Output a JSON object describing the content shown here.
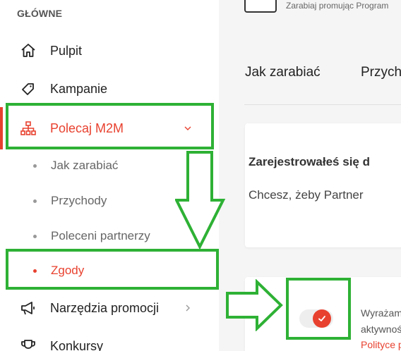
{
  "sidebar": {
    "section_title": "GŁÓWNE",
    "items": [
      {
        "label": "Pulpit",
        "icon": "home-icon"
      },
      {
        "label": "Kampanie",
        "icon": "tag-icon"
      },
      {
        "label": "Polecaj M2M",
        "icon": "sitemap-icon",
        "active": true,
        "expanded": true
      },
      {
        "label": "Narzędzia promocji",
        "icon": "megaphone-icon"
      },
      {
        "label": "Konkursy",
        "icon": "trophy-icon"
      }
    ],
    "subitems": [
      {
        "label": "Jak zarabiać"
      },
      {
        "label": "Przychody"
      },
      {
        "label": "Poleceni partnerzy"
      },
      {
        "label": "Zgody",
        "active": true
      }
    ]
  },
  "main": {
    "header_subtitle": "Zarabiaj promując Program",
    "tabs": [
      "Jak zarabiać",
      "Przych"
    ],
    "card": {
      "title": "Zarejestrowałeś się d",
      "text": "Chcesz, żeby Partner"
    },
    "consent": {
      "line1": "Wyrażam",
      "line2": "aktywnoś",
      "link": "Polityce p",
      "checked": true
    }
  },
  "colors": {
    "accent": "#e8412f",
    "highlight": "#2eb135"
  }
}
